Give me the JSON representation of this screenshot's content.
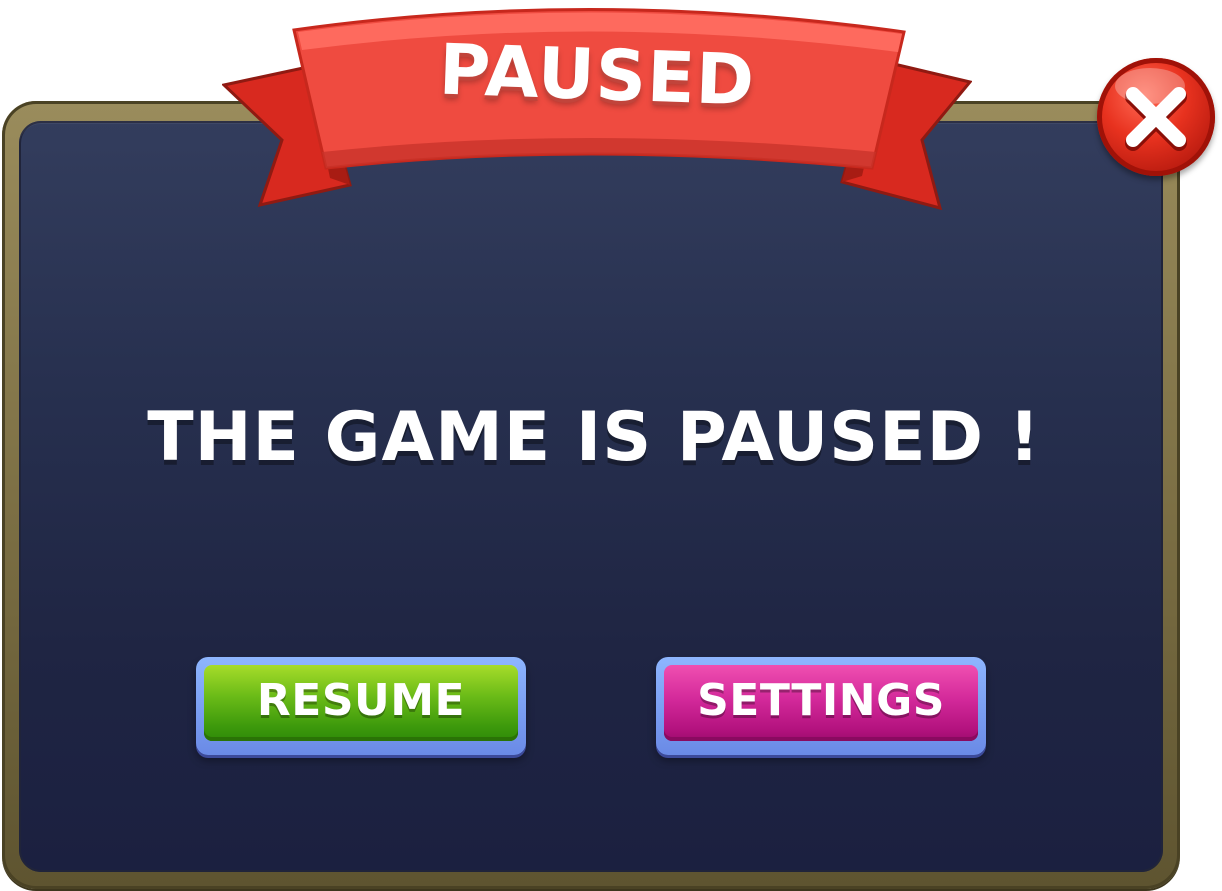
{
  "dialog": {
    "title": "PAUSED",
    "message": "THE GAME IS PAUSED !"
  },
  "buttons": {
    "resume_label": "RESUME",
    "settings_label": "SETTINGS"
  },
  "icons": {
    "close": "close-icon"
  },
  "colors": {
    "ribbon": "#ef4b40",
    "panel": "#252c4b",
    "frame": "#7d7045",
    "resume": "#5cb314",
    "settings": "#c81d8c",
    "close": "#e8321f"
  }
}
